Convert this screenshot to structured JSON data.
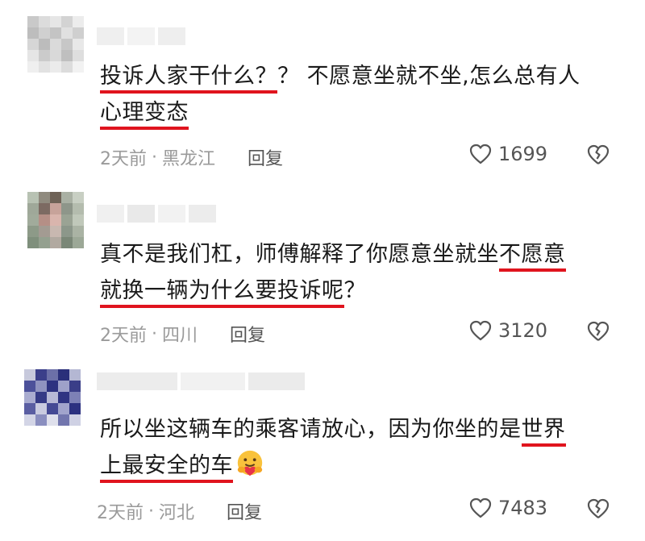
{
  "comments": [
    {
      "line1_ul": "投诉人家干什么？",
      "line1_rest": "？ 不愿意坐就不坐,怎么总有人",
      "line2_ul": "心理变态",
      "time": "2天前",
      "sep": "·",
      "location": "黑龙江",
      "reply": "回复",
      "likes": "1699"
    },
    {
      "line1_plain": "真不是我们杠，师傅解释了你愿意坐就坐",
      "line1_ul": "不愿意",
      "line2_ul": "就换一辆为什么要投诉呢",
      "line2_rest": "？",
      "time": "2天前",
      "sep": "·",
      "location": "四川",
      "reply": "回复",
      "likes": "3120"
    },
    {
      "line1_plain": "所以坐这辆车的乘客请放心，因为你坐的是",
      "line1_ul": "世界",
      "line2_ul": "上最安全的车",
      "time": "2天前",
      "sep": "·",
      "location": "河北",
      "reply": "回复",
      "likes": "7483",
      "emoji": "hug-face-emoji"
    }
  ],
  "colors": {
    "underline": "#e0141e",
    "meta": "#9a9a9a"
  },
  "icons": {
    "like": "heart-outline-icon",
    "dislike": "broken-heart-icon"
  }
}
